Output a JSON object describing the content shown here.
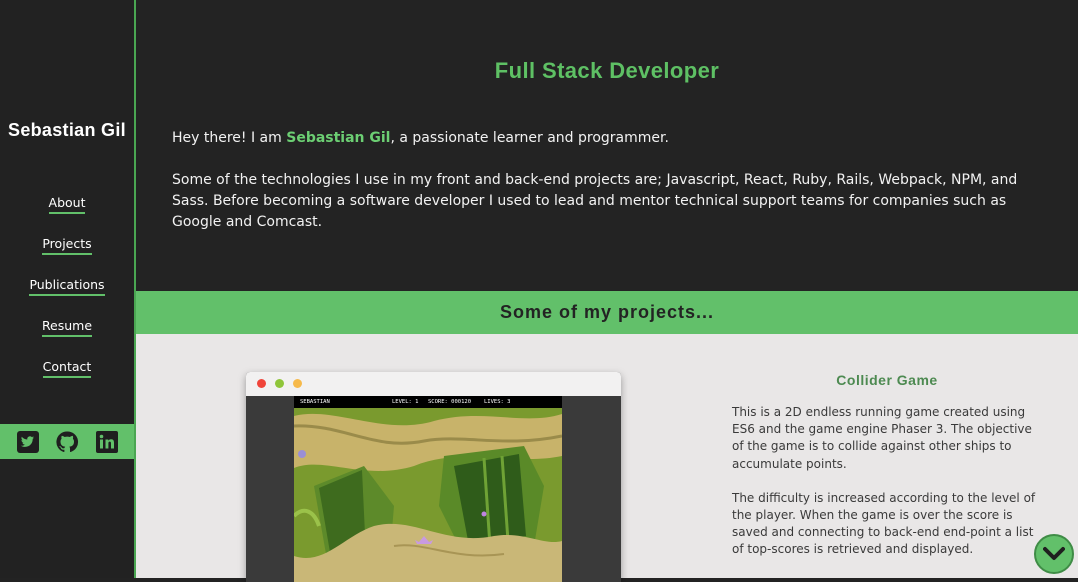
{
  "sidebar": {
    "brand": "Sebastian Gil",
    "nav": [
      {
        "label": "About"
      },
      {
        "label": "Projects"
      },
      {
        "label": "Publications"
      },
      {
        "label": "Resume"
      },
      {
        "label": "Contact"
      }
    ],
    "social_icons": [
      "twitter-icon",
      "github-icon",
      "linkedin-icon"
    ]
  },
  "hero": {
    "title": "Full Stack Developer",
    "intro_prefix": "Hey there! I am ",
    "intro_name": "Sebastian Gil",
    "intro_suffix": ", a passionate learner and programmer.",
    "about": "Some of the technologies I use in my front and back-end projects are; Javascript, React, Ruby, Rails, Webpack, NPM, and Sass. Before becoming a software developer I used to lead and mentor technical support teams for companies such as Google and Comcast."
  },
  "projects_banner": "Some of my projects...",
  "project": {
    "title": "Collider Game",
    "desc1": "This is a 2D endless running game created using ES6 and the game engine Phaser 3. The objective of the game is to collide against other ships to accumulate points.",
    "desc2": "The difficulty is increased according to the level of the player. When the game is over the score is saved and connecting to back-end end-point a list of top-scores is retrieved and displayed.",
    "game_hud": {
      "player": "SEBASTIAN",
      "level": "LEVEL: 1",
      "score": "SCORE: 000120",
      "lives": "LIVES: 3"
    }
  },
  "colors": {
    "accent": "#62c06a",
    "background": "#232323",
    "projects_bg": "#e9e7e7"
  }
}
